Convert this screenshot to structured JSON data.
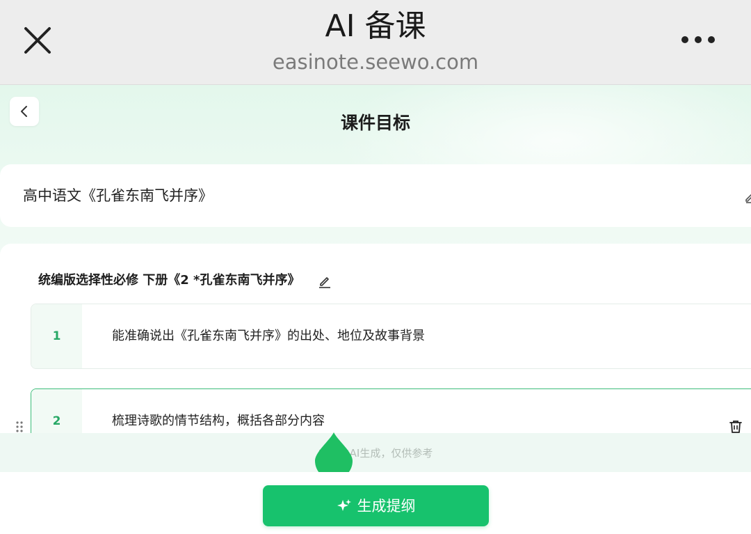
{
  "window": {
    "title": "AI 备课",
    "url": "easinote.seewo.com",
    "close_icon": "close-icon",
    "more_icon": "more-horizontal-icon"
  },
  "page": {
    "title": "课件目标",
    "back_icon": "chevron-left-icon"
  },
  "course": {
    "name": "高中语文《孔雀东南飞并序》",
    "edit_icon": "pencil-icon"
  },
  "goals": {
    "textbook": "统编版选择性必修 下册《2 *孔雀东南飞并序》",
    "items": [
      {
        "num": "1",
        "text": "能准确说出《孔雀东南飞并序》的出处、地位及故事背景"
      },
      {
        "num": "2",
        "text": "梳理诗歌的情节结构，概括各部分内容"
      }
    ]
  },
  "footer": {
    "disclaimer": "内容由AI生成，仅供参考"
  },
  "actions": {
    "generate_label": "生成提纲",
    "generate_icon": "sparkle-icon"
  },
  "colors": {
    "accent": "#17c26d",
    "number": "#28a866",
    "active_border": "#3dbd7a"
  }
}
